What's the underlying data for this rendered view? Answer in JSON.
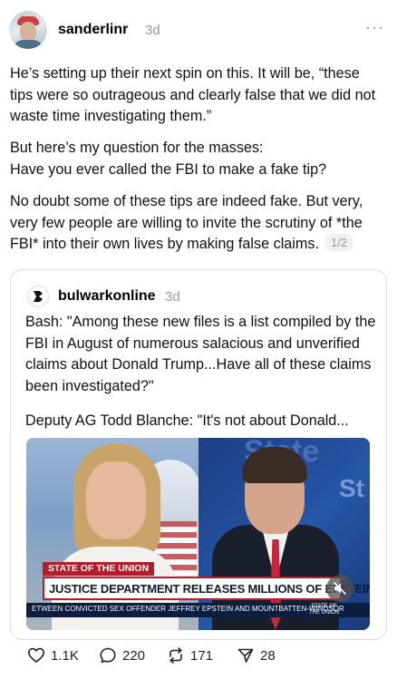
{
  "post": {
    "username": "sanderlinr",
    "timestamp": "3d",
    "more_label": "···",
    "paragraphs": [
      "He’s setting up their next spin on this. It will be, “these tips were so outrageous and clearly false that we did not waste time investigating them.”",
      "But here’s my question for the masses: Have you ever called the FBI to make a fake tip?",
      "No doubt some of these tips are indeed fake. But very, very few people are willing to invite the scrutiny of *the FBI* into their own lives by making false claims."
    ],
    "p2_line1": "But here’s my question for the masses:",
    "p2_line2": "Have you ever called the FBI to make a fake tip?",
    "pager": "1/2"
  },
  "quote": {
    "username": "bulwarkonline",
    "timestamp": "3d",
    "paragraphs": [
      "Bash: \"Among these new files is a list compiled by the FBI in August of numerous salacious and unverified claims about Donald Trump...Have all of these claims been investigated?\"",
      "Deputy AG Todd Blanche: \"It's not about Donald..."
    ],
    "video": {
      "tag": "STATE OF THE UNION",
      "headline": "JUSTICE DEPARTMENT RELEASES MILLIONS OF EPSTEIN FILES",
      "ticker": "ETWEEN CONVICTED SEX OFFENDER JEFFREY EPSTEIN AND MOUNTBATTEN-WINDSOR",
      "logo_line1": "STATE OF",
      "logo_line2": "THE UNION",
      "backdrop_word": "State",
      "backdrop_side": "St"
    }
  },
  "actions": {
    "likes": "1.1K",
    "replies": "220",
    "reposts": "171",
    "shares": "28"
  },
  "icons": [
    "avatar",
    "more-icon",
    "heart-icon",
    "comment-icon",
    "repost-icon",
    "share-icon",
    "mute-icon"
  ],
  "colors": {
    "muted_text": "#999999",
    "border": "#dcdcdc",
    "cnn_red": "#b21e2b"
  }
}
